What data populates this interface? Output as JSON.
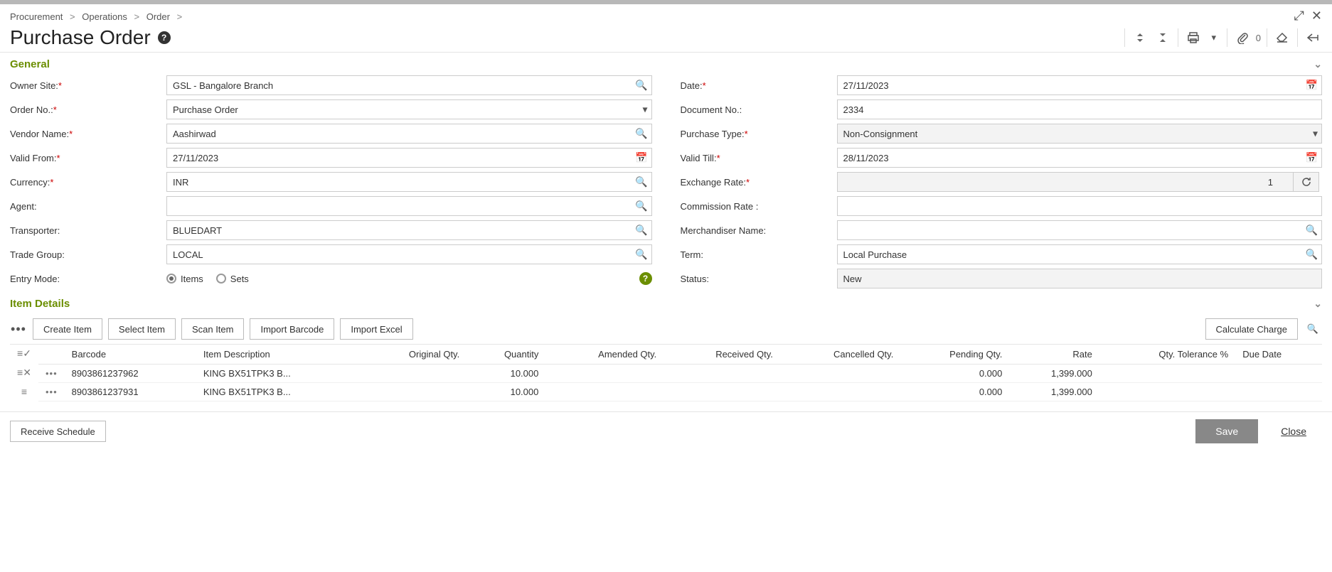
{
  "breadcrumb": [
    "Procurement",
    "Operations",
    "Order"
  ],
  "page_title": "Purchase Order",
  "attachment_count": "0",
  "sections": {
    "general": "General",
    "item_details": "Item Details"
  },
  "form": {
    "owner_site": {
      "label": "Owner Site:",
      "value": "GSL - Bangalore Branch"
    },
    "order_no": {
      "label": "Order No.:",
      "value": "Purchase Order"
    },
    "vendor_name": {
      "label": "Vendor Name:",
      "value": "Aashirwad"
    },
    "valid_from": {
      "label": "Valid From:",
      "value": "27/11/2023"
    },
    "currency": {
      "label": "Currency:",
      "value": "INR"
    },
    "agent": {
      "label": "Agent:",
      "value": ""
    },
    "transporter": {
      "label": "Transporter:",
      "value": "BLUEDART"
    },
    "trade_group": {
      "label": "Trade Group:",
      "value": "LOCAL"
    },
    "entry_mode": {
      "label": "Entry Mode:",
      "options": [
        "Items",
        "Sets"
      ],
      "selected": "Items"
    },
    "date": {
      "label": "Date:",
      "value": "27/11/2023"
    },
    "document_no": {
      "label": "Document No.:",
      "value": "2334"
    },
    "purchase_type": {
      "label": "Purchase Type:",
      "value": "Non-Consignment"
    },
    "valid_till": {
      "label": "Valid Till:",
      "value": "28/11/2023"
    },
    "exchange_rate": {
      "label": "Exchange Rate:",
      "value": "1"
    },
    "commission_rate": {
      "label": "Commission Rate :",
      "value": ""
    },
    "merchandiser": {
      "label": "Merchandiser Name:",
      "value": ""
    },
    "term": {
      "label": "Term:",
      "value": "Local Purchase"
    },
    "status": {
      "label": "Status:",
      "value": "New"
    }
  },
  "item_toolbar": {
    "create": "Create Item",
    "select": "Select Item",
    "scan": "Scan Item",
    "import_barcode": "Import Barcode",
    "import_excel": "Import Excel",
    "calc_charge": "Calculate Charge"
  },
  "grid": {
    "headers": [
      "Barcode",
      "Item Description",
      "Original Qty.",
      "Quantity",
      "Amended Qty.",
      "Received Qty.",
      "Cancelled Qty.",
      "Pending Qty.",
      "Rate",
      "Qty. Tolerance %",
      "Due Date"
    ],
    "rows": [
      {
        "barcode": "8903861237962",
        "desc": "KING BX51TPK3 B...",
        "original_qty": "",
        "quantity": "10.000",
        "amended": "",
        "received": "",
        "cancelled": "",
        "pending": "0.000",
        "rate": "1,399.000",
        "tolerance": "",
        "due": ""
      },
      {
        "barcode": "8903861237931",
        "desc": "KING BX51TPK3 B...",
        "original_qty": "",
        "quantity": "10.000",
        "amended": "",
        "received": "",
        "cancelled": "",
        "pending": "0.000",
        "rate": "1,399.000",
        "tolerance": "",
        "due": ""
      }
    ]
  },
  "footer": {
    "receive_schedule": "Receive Schedule",
    "save": "Save",
    "close": "Close"
  }
}
